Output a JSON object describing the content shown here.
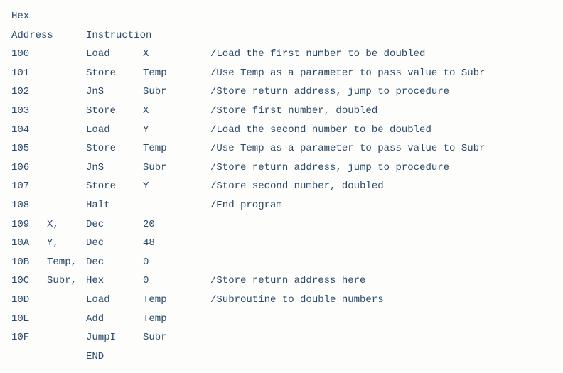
{
  "header": {
    "line1_col1": "Hex",
    "line2_col1": "Address",
    "line2_col2": "Instruction"
  },
  "rows": [
    {
      "addr": "100",
      "label": "",
      "opcode": "Load",
      "operand": "X",
      "comment": "/Load the first number to be doubled"
    },
    {
      "addr": "101",
      "label": "",
      "opcode": "Store",
      "operand": "Temp",
      "comment": "/Use Temp as a parameter to pass value to Subr"
    },
    {
      "addr": "102",
      "label": "",
      "opcode": "JnS",
      "operand": "Subr",
      "comment": "/Store return address, jump to procedure"
    },
    {
      "addr": "103",
      "label": "",
      "opcode": "Store",
      "operand": "X",
      "comment": "/Store first number, doubled"
    },
    {
      "addr": "104",
      "label": "",
      "opcode": "Load",
      "operand": "Y",
      "comment": "/Load the second number to be doubled"
    },
    {
      "addr": "105",
      "label": "",
      "opcode": "Store",
      "operand": "Temp",
      "comment": "/Use Temp as a parameter to pass value to Subr"
    },
    {
      "addr": "106",
      "label": "",
      "opcode": "JnS",
      "operand": "Subr",
      "comment": "/Store return address, jump to procedure"
    },
    {
      "addr": "107",
      "label": "",
      "opcode": "Store",
      "operand": "Y",
      "comment": "/Store second number, doubled"
    },
    {
      "addr": "108",
      "label": "",
      "opcode": "Halt",
      "operand": "",
      "comment": "/End program"
    },
    {
      "addr": "109",
      "label": "X,",
      "opcode": "Dec",
      "operand": "20",
      "comment": ""
    },
    {
      "addr": "10A",
      "label": "Y,",
      "opcode": "Dec",
      "operand": "48",
      "comment": ""
    },
    {
      "addr": "10B",
      "label": "Temp,",
      "opcode": "Dec",
      "operand": "0",
      "comment": ""
    },
    {
      "addr": "10C",
      "label": "Subr,",
      "opcode": "Hex",
      "operand": "0",
      "comment": "/Store return address here"
    },
    {
      "addr": "10D",
      "label": "",
      "opcode": "Load",
      "operand": "Temp",
      "comment": "/Subroutine to double numbers"
    },
    {
      "addr": "10E",
      "label": "",
      "opcode": "Add",
      "operand": "Temp",
      "comment": ""
    },
    {
      "addr": "10F",
      "label": "",
      "opcode": "JumpI",
      "operand": "Subr",
      "comment": ""
    },
    {
      "addr": "",
      "label": "",
      "opcode": "END",
      "operand": "",
      "comment": ""
    }
  ]
}
